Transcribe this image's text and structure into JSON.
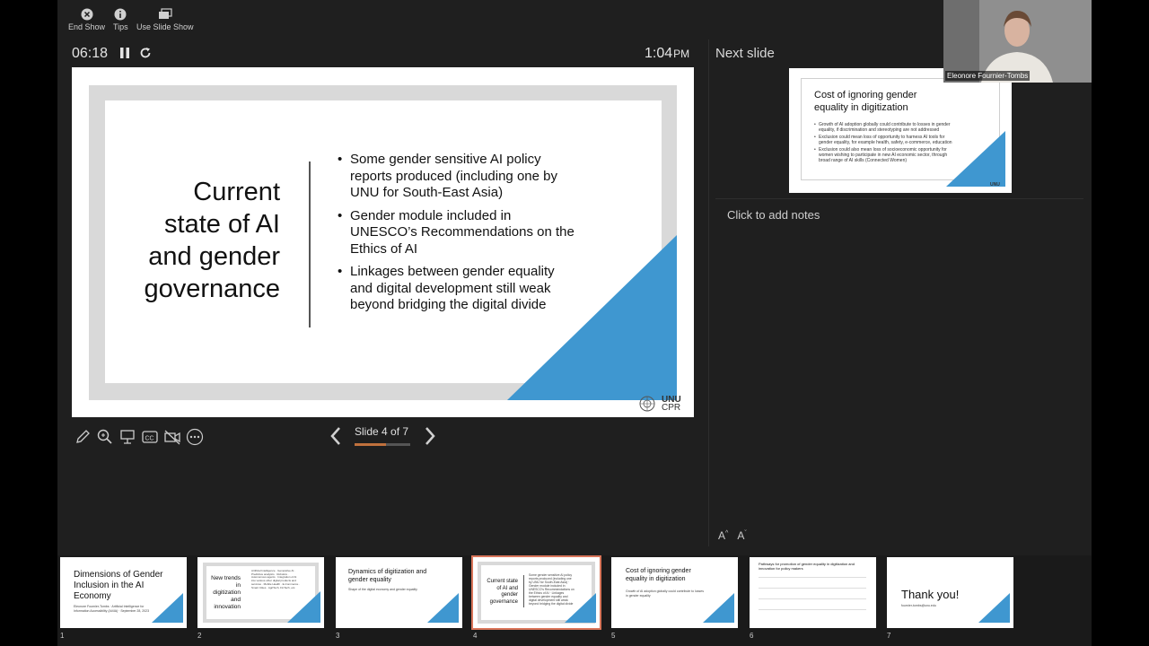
{
  "toolbar": {
    "end_show": "End Show",
    "tips": "Tips",
    "use_slide_show": "Use Slide Show"
  },
  "timer": "06:18",
  "clock": {
    "time": "1:04",
    "ampm": "PM"
  },
  "current_slide": {
    "title_lines": [
      "Current",
      "state of AI",
      "and gender",
      "governance"
    ],
    "bullets": [
      "Some gender sensitive AI policy reports produced (including one by UNU for South-East Asia)",
      "Gender module included in UNESCO’s Recommendations on the Ethics of AI",
      "Linkages between gender equality and digital development still weak beyond bridging the digital divide"
    ],
    "logo_text": "UNU",
    "logo_sub": "CPR"
  },
  "navigation": {
    "slide_counter": "Slide 4 of 7",
    "progress": 0.571
  },
  "next_slide": {
    "label": "Next slide",
    "title": "Cost of ignoring gender equality in digitization",
    "bullets": [
      "Growth of AI adoption globally could contribute to losses in gender equality, if discrimination and stereotyping are not addressed",
      "Exclusion could mean loss of opportunity to harness AI tools for gender equality, for example health, safety, e-commerce, education",
      "Exclusion could also mean loss of socioeconomic opportunity for women wishing to participate in new AI economic sector, through broad range of AI skills (Connected Women)"
    ]
  },
  "notes": {
    "placeholder": "Click to add notes"
  },
  "font_buttons": {
    "increase": "A",
    "decrease": "A"
  },
  "video": {
    "name": "Eleonore Fournier-Tombs"
  },
  "thumbnails": [
    {
      "num": "1",
      "title": "Dimensions of Gender Inclusion in the AI Economy",
      "body": "Eleonore Fournier-Tombs · Artificial Intelligence for Information Accessibility (AI4IA) · September 28, 2023"
    },
    {
      "num": "2",
      "title": "New trends in digitization and innovation",
      "body": "Artificial Intelligence · Generative AI · Predictive analytics · Robotics · Autonomous agents · Integration of AI into various other digital products and services · Mobile Health · E-Commerce · Smart Cities · AgriTech, FinTech, etc."
    },
    {
      "num": "3",
      "title": "Dynamics of digitization and gender equality",
      "body": "Shape of the digital economy and gender equality"
    },
    {
      "num": "4",
      "title": "Current state of AI and gender governance",
      "body": "Some gender sensitive AI policy reports produced (including one by UNU for South-East Asia) · Gender module included in UNESCO’s Recommendations on the Ethics of AI · Linkages between gender equality and digital development still weak beyond bridging the digital divide"
    },
    {
      "num": "5",
      "title": "Cost of ignoring gender equality in digitization",
      "body": "Growth of AI adoption globally could contribute to losses in gender equality"
    },
    {
      "num": "6",
      "title": "Pathways for promotion of gender equality in digitization and innovation for policy makers",
      "body": ""
    },
    {
      "num": "7",
      "title": "Thank you!",
      "body": "fournier-tombs@unu.edu"
    }
  ],
  "colors": {
    "accent_blue": "#3f97d0",
    "progress": "#c0713d",
    "selected_thumb": "#d9755a"
  }
}
